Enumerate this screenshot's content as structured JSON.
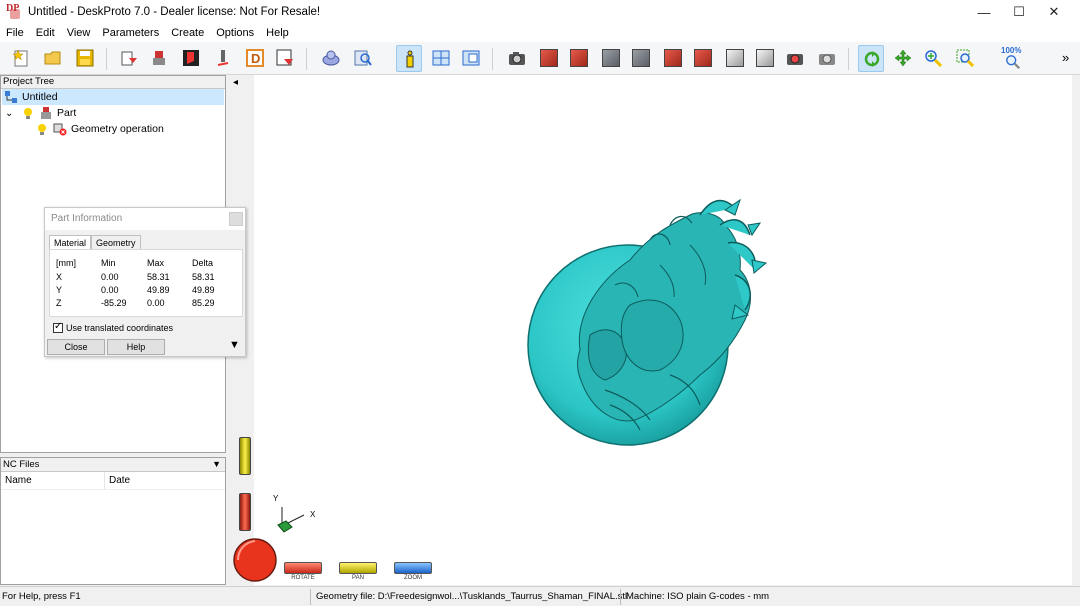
{
  "window": {
    "title": "Untitled - DeskProto 7.0 - Dealer license: Not For Resale!",
    "minimize": "—",
    "maximize": "☐",
    "close": "✕"
  },
  "menu": [
    "File",
    "Edit",
    "View",
    "Parameters",
    "Create",
    "Options",
    "Help"
  ],
  "toolbar": {
    "zoom_label": "100%",
    "overflow": "»"
  },
  "project_tree": {
    "header": "Project Tree",
    "root": "Untitled",
    "part": "Part",
    "operation": "Geometry operation"
  },
  "part_information": {
    "title": "Part Information",
    "tabs": [
      "Material",
      "Geometry"
    ],
    "columns": [
      "[mm]",
      "Min",
      "Max",
      "Delta"
    ],
    "rows": [
      {
        "axis": "X",
        "min": "0.00",
        "max": "58.31",
        "delta": "58.31"
      },
      {
        "axis": "Y",
        "min": "0.00",
        "max": "49.89",
        "delta": "49.89"
      },
      {
        "axis": "Z",
        "min": "-85.29",
        "max": "0.00",
        "delta": "85.29"
      }
    ],
    "checkbox_label": "Use translated coordinates",
    "close_label": "Close",
    "help_label": "Help"
  },
  "nc_files": {
    "header": "NC Files",
    "col_name": "Name",
    "col_date": "Date"
  },
  "viewport": {
    "axis_y": "Y",
    "axis_x": "X",
    "mode_rotate": "ROTATE",
    "mode_pan": "PAN",
    "mode_zoom": "ZOOM",
    "collapse_arrow": "◂",
    "model_color": "#2cc6c6"
  },
  "status": {
    "help": "For Help, press F1",
    "geometry_file": "Geometry file: D:\\Freedesignwol...\\Tusklands_Taurrus_Shaman_FINAL.stl",
    "machine": "Machine: ISO plain G-codes - mm"
  }
}
